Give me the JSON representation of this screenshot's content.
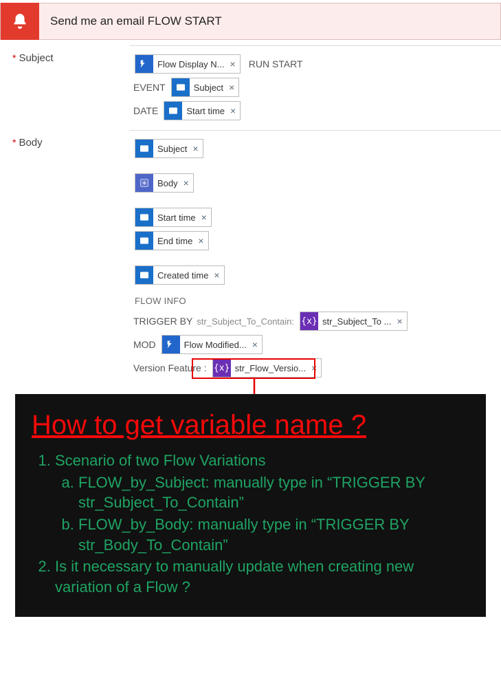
{
  "header": {
    "title": "Send me an email FLOW START"
  },
  "subject": {
    "label": "Subject",
    "post1": "RUN START",
    "pre2": "EVENT",
    "pre3": "DATE",
    "tok_flow_display": "Flow Display N...",
    "tok_subject": "Subject",
    "tok_start": "Start time"
  },
  "body": {
    "label": "Body",
    "tok_subject": "Subject",
    "tok_body": "Body",
    "tok_start": "Start time",
    "tok_end": "End time",
    "tok_created": "Created time",
    "flow_info_label": "FLOW INFO",
    "trigger_by": "TRIGGER BY",
    "trigger_hidden": "str_Subject_To_Contain:",
    "tok_str_sub": "str_Subject_To ...",
    "mod_label": "MOD",
    "tok_flow_mod": "Flow Modified...",
    "version_label": "Version Feature :",
    "tok_str_ver": "str_Flow_Versio..."
  },
  "annotation": {
    "title": "How to get variable name ?",
    "l1": "Scenario of two Flow Variations",
    "l1a": "FLOW_by_Subject: manually type in “TRIGGER BY str_Subject_To_Contain”",
    "l1b": "FLOW_by_Body: manually type in “TRIGGER BY str_Body_To_Contain”",
    "l2": "Is it necessary to manually update when creating new variation of a Flow ?"
  }
}
